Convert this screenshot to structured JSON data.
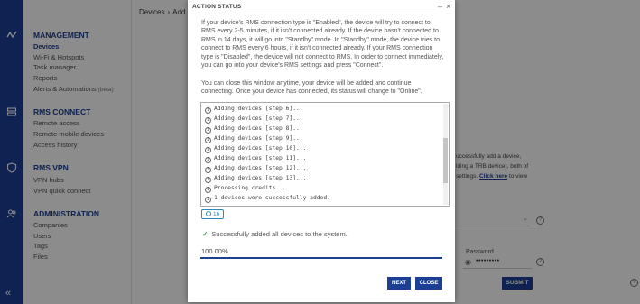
{
  "breadcrumb": {
    "root": "Devices",
    "current": "Add"
  },
  "sidebar": {
    "sections": [
      {
        "title": "MANAGEMENT",
        "items": [
          "Devices",
          "Wi-Fi & Hotspots",
          "Task manager",
          "Reports",
          "Alerts & Automations"
        ],
        "beta": "(beta)"
      },
      {
        "title": "RMS CONNECT",
        "items": [
          "Remote access",
          "Remote mobile devices",
          "Access history"
        ]
      },
      {
        "title": "RMS VPN",
        "items": [
          "VPN hubs",
          "VPN quick connect"
        ]
      },
      {
        "title": "ADMINISTRATION",
        "items": [
          "Companies",
          "Users",
          "Tags",
          "Files"
        ]
      }
    ],
    "active_item": "Devices",
    "collapse_glyph": "«"
  },
  "background": {
    "info_line1": "uccessfully add a device,",
    "info_line2": "lding a TRB device), both of",
    "info_line3_prefix": "settings.",
    "info_link": "Click here",
    "info_line3_suffix": "to view",
    "password_label": "Password",
    "password_value": "•••••••••",
    "submit_label": "SUBMIT"
  },
  "modal": {
    "title": "ACTION STATUS",
    "minimize_glyph": "–",
    "close_glyph": "×",
    "paragraph1": "If your device's RMS connection type is \"Enabled\", the device will try to connect to RMS every 2-5 minutes, if it isn't connected already. If the device hasn't connected to RMS in 14 days, it will go into \"Standby\" mode. In \"Standby\" mode, the device tries to connect to RMS every 6 hours, if it isn't connected already. If your RMS connection type is \"Disabled\", the device will not connect to RMS. In order to connect immediately, you can go into your device's RMS settings and press \"Connect\".",
    "paragraph2": "You can close this window anytime, your device will be added and continue connecting. Once your device has connected, its status will change to \"Online\".",
    "log_lines": [
      "Adding devices [step 6]...",
      "Adding devices [step 7]...",
      "Adding devices [step 8]...",
      "Adding devices [step 9]...",
      "Adding devices [step 10]...",
      "Adding devices [step 11]...",
      "Adding devices [step 12]...",
      "Adding devices [step 13]...",
      "Processing credits...",
      "1 devices were successfully added."
    ],
    "log_count": "16",
    "success_message": "Successfully added all devices to the system.",
    "progress_text": "100.00%",
    "progress_fraction": 1.0,
    "next_label": "NEXT",
    "close_label": "CLOSE"
  },
  "colors": {
    "brand": "#1c3f94",
    "success": "#3a9a4a",
    "info": "#2e8bc0"
  }
}
